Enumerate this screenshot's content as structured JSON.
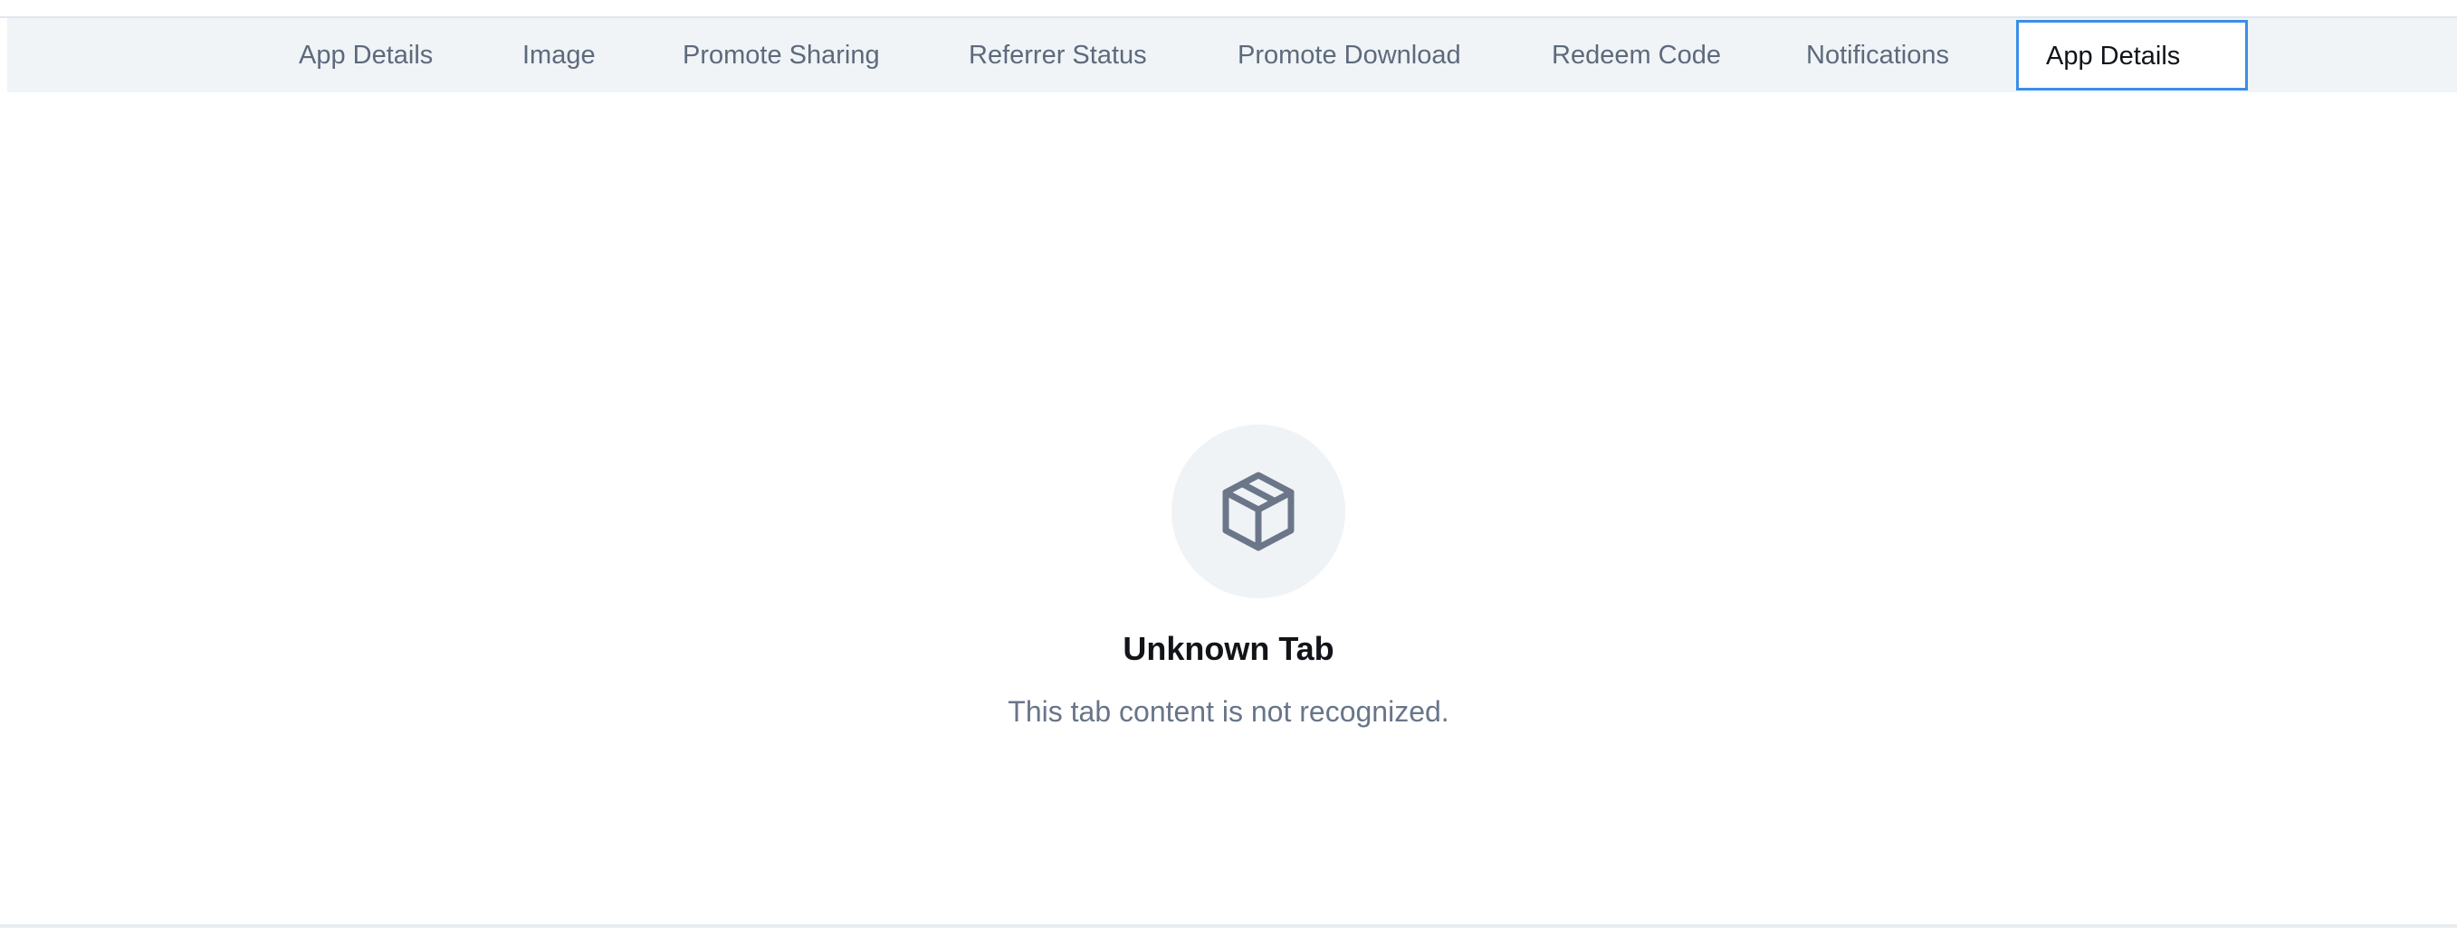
{
  "tabs": [
    {
      "label": "App Details",
      "active": false
    },
    {
      "label": "Image",
      "active": false
    },
    {
      "label": "Promote Sharing",
      "active": false
    },
    {
      "label": "Referrer Status",
      "active": false
    },
    {
      "label": "Promote Download",
      "active": false
    },
    {
      "label": "Redeem Code",
      "active": false
    },
    {
      "label": "Notifications",
      "active": false
    },
    {
      "label": "App Details",
      "active": true
    }
  ],
  "empty_state": {
    "icon": "package-box-icon",
    "title": "Unknown Tab",
    "description": "This tab content is not recognized."
  },
  "colors": {
    "tabbar_bg": "#f0f4f7",
    "tab_text": "#5d6a7c",
    "active_border": "#3b8ee8",
    "icon_stroke": "#6b7789",
    "icon_bg": "#f0f3f6"
  }
}
